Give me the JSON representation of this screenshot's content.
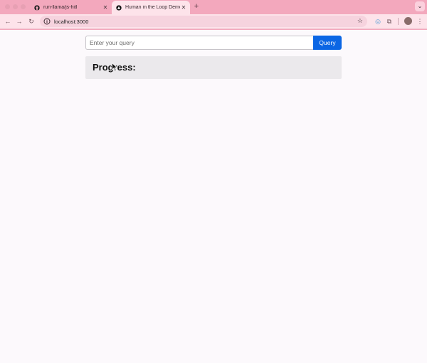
{
  "browser": {
    "tabs": [
      {
        "label": "run-llama/js-hitl",
        "icon": "github-icon",
        "active": false
      },
      {
        "label": "Human in the Loop Demo",
        "icon": "app-favicon",
        "active": true
      }
    ],
    "new_tab_symbol": "+",
    "url": "localhost:3000"
  },
  "app": {
    "query_placeholder": "Enter your query",
    "query_value": "",
    "query_button_label": "Query",
    "progress_heading": "Progress:"
  },
  "colors": {
    "chrome": "#f3a8bd",
    "toolbar": "#fde3ea",
    "button": "#0b66e4",
    "progress_panel": "#ebe9ec"
  }
}
